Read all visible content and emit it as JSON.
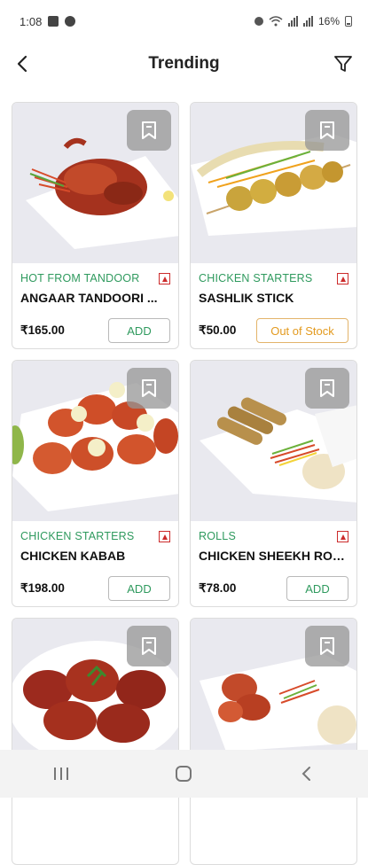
{
  "status_bar": {
    "time": "1:08",
    "battery": "16%"
  },
  "header": {
    "title": "Trending"
  },
  "products": [
    {
      "category": "HOT FROM TANDOOR",
      "name": "ANGAAR TANDOORI ...",
      "price": "₹165.00",
      "action": "ADD"
    },
    {
      "category": "CHICKEN STARTERS",
      "name": "SASHLIK STICK",
      "price": "₹50.00",
      "action": "Out of Stock"
    },
    {
      "category": "CHICKEN STARTERS",
      "name": "CHICKEN KABAB",
      "price": "₹198.00",
      "action": "ADD"
    },
    {
      "category": "ROLLS",
      "name": "CHICKEN SHEEKH ROLL ...",
      "price": "₹78.00",
      "action": "ADD"
    },
    {
      "category": "",
      "name": "",
      "price": "",
      "action": ""
    },
    {
      "category": "",
      "name": "",
      "price": "",
      "action": ""
    }
  ],
  "colors": {
    "accent_green": "#2f9a5e",
    "out_of_stock": "#e39a1f",
    "nonveg_mark": "#cc2b2b"
  },
  "icons": {
    "back": "chevron-left-icon",
    "filter": "filter-icon",
    "bookmark": "bookmark-icon"
  }
}
